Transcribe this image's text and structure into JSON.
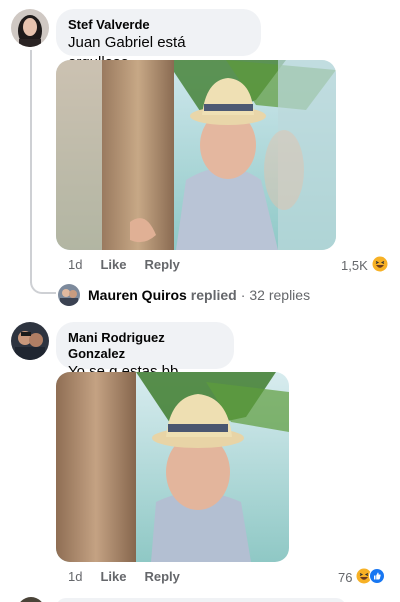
{
  "comments": [
    {
      "author": "Stef Valverde",
      "text": "Juan Gabriel está orgulloso",
      "time": "1d",
      "like": "Like",
      "reply": "Reply",
      "reaction_count": "1,5K",
      "reaction_icons": [
        "haha-icon"
      ]
    },
    {
      "author": "Mani Rodriguez Gonzalez",
      "text": "Yo se q estas bb",
      "time": "1d",
      "like": "Like",
      "reply": "Reply",
      "reaction_count": "76",
      "reaction_icons": [
        "haha-icon",
        "like-icon"
      ]
    }
  ],
  "replies_summary": {
    "name": "Mauren Quiros",
    "verb": "replied",
    "separator": "·",
    "count": "32 replies"
  },
  "colors": {
    "bubble": "#f0f2f5",
    "secondary_text": "#65676b",
    "like_blue": "#1877f2",
    "haha_yellow": "#f7b125"
  }
}
